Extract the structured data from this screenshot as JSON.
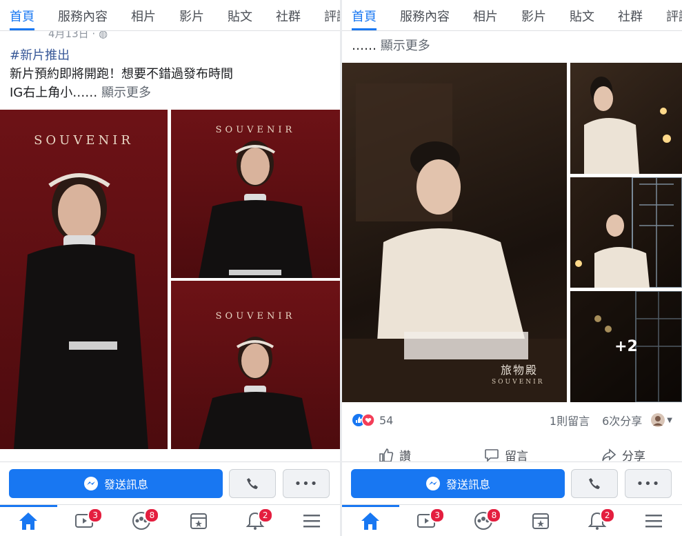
{
  "tabs": [
    "首頁",
    "服務內容",
    "相片",
    "影片",
    "貼文",
    "社群",
    "評論"
  ],
  "left_post": {
    "date": "4月13日 · ",
    "hashtag": "#新片推出",
    "line1": "新片預約即將開跑！想要不錯過發布時間",
    "line2": "IG右上角小……",
    "see_more": "顯示更多",
    "souvenir_label": "SOUVENIR"
  },
  "right_post": {
    "truncated_text": "……",
    "see_more": "顯示更多",
    "brand_cn": "旅物殿",
    "brand_en": "SOUVENIR",
    "more_photos": "+2",
    "reaction_count": "54",
    "comment_count": "1則留言",
    "share_count": "6次分享",
    "like_label": "讚",
    "comment_label": "留言",
    "share_label": "分享"
  },
  "bottom": {
    "send_message": "發送訊息"
  },
  "nav": {
    "watch_badge": "3",
    "groups_badge": "8",
    "notifications_badge": "2"
  },
  "colors": {
    "accent": "#1877f2",
    "badge": "#e41e3f",
    "backdrop": "#6b0f12"
  }
}
